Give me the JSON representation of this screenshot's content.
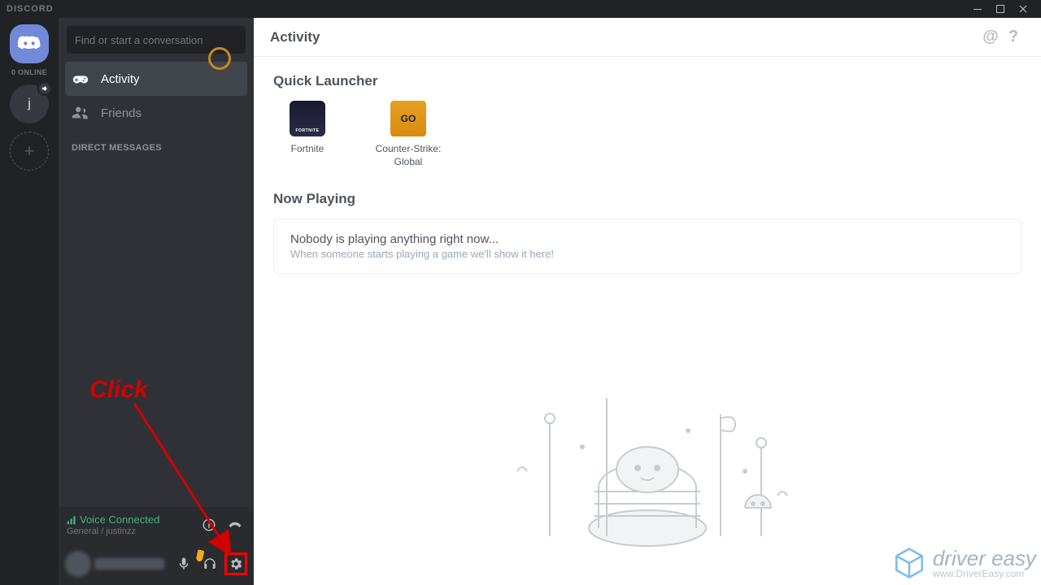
{
  "titlebar": {
    "brand": "DISCORD"
  },
  "guilds": {
    "online_label": "0 ONLINE",
    "server1_initial": "j"
  },
  "channels": {
    "search_placeholder": "Find or start a conversation",
    "activity_label": "Activity",
    "friends_label": "Friends",
    "dm_header": "DIRECT MESSAGES"
  },
  "voice": {
    "status": "Voice Connected",
    "channel": "General / justinzz"
  },
  "main": {
    "title": "Activity",
    "quick_launcher": "Quick Launcher",
    "games": [
      {
        "label": "Fortnite"
      },
      {
        "label": "Counter-Strike: Global"
      }
    ],
    "cs_tile_text": "GO",
    "now_playing": "Now Playing",
    "np_empty_title": "Nobody is playing anything right now...",
    "np_empty_sub": "When someone starts playing a game we'll show it here!"
  },
  "annotation": {
    "click_text": "Click"
  },
  "watermark": {
    "line1": "driver easy",
    "line2": "www.DriverEasy.com"
  }
}
